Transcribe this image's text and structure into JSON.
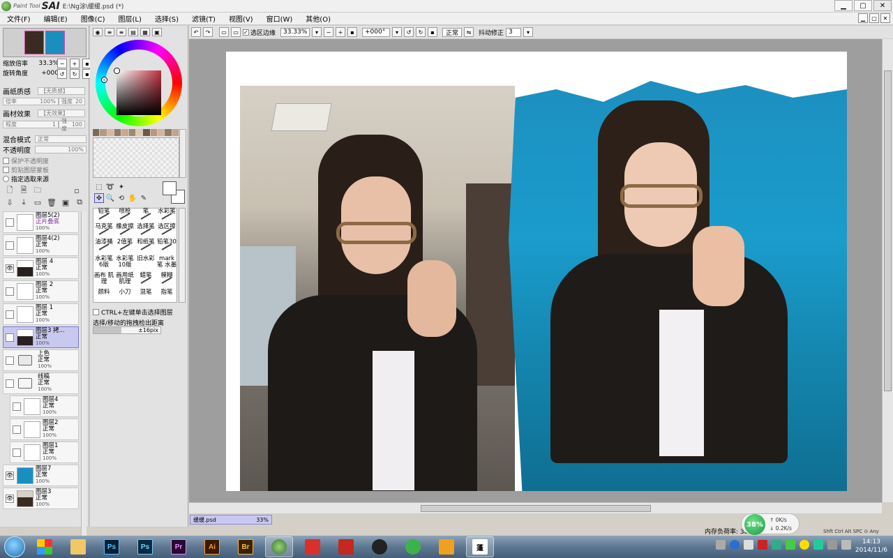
{
  "titlebar": {
    "app_small": "Paint Tool",
    "app_big": "SAI",
    "path": "E:\\Ng涂\\缓缓.psd (*)",
    "btn_min": "▁",
    "btn_max": "▢",
    "btn_close": "✕"
  },
  "menu": [
    "文件(F)",
    "编辑(E)",
    "图像(C)",
    "图层(L)",
    "选择(S)",
    "滤镜(T)",
    "视图(V)",
    "窗口(W)",
    "其他(O)"
  ],
  "nav": {
    "zoom_label": "缩放倍率",
    "zoom_value": "33.3%",
    "angle_label": "旋转角度",
    "angle_value": "+000"
  },
  "texture": {
    "paper_label": "画纸质感",
    "paper_value": "【无质感】",
    "mag_label": "倍率",
    "mag_value": "100%",
    "strength_label": "强度",
    "strength_value": "20",
    "effect_label": "画材效果",
    "effect_value": "【无效果】",
    "degree_label": "程度",
    "degree_value": "1",
    "effect_strength_label": "强度",
    "effect_strength_value": "100"
  },
  "blend": {
    "mode_label": "混合模式",
    "mode_value": "正常",
    "opacity_label": "不透明度",
    "opacity_value": "100%",
    "protect_opacity": "保护不透明度",
    "clip_group": "剪贴图层蒙板",
    "selection_source": "指定选取来源"
  },
  "layers": [
    {
      "name": "图层5(2)",
      "mode": "正片叠底",
      "opacity": "100%",
      "visible": false,
      "selected": false,
      "kind": "layer"
    },
    {
      "name": "图层4(2)",
      "mode": "正常",
      "opacity": "100%",
      "visible": false,
      "selected": false,
      "kind": "layer"
    },
    {
      "name": "图层 4",
      "mode": "正常",
      "opacity": "100%",
      "visible": true,
      "selected": false,
      "kind": "layer"
    },
    {
      "name": "图层 2",
      "mode": "正常",
      "opacity": "100%",
      "visible": false,
      "selected": false,
      "kind": "layer"
    },
    {
      "name": "图层 1",
      "mode": "正常",
      "opacity": "100%",
      "visible": false,
      "selected": false,
      "kind": "layer"
    },
    {
      "name": "图层3 拷...",
      "mode": "正常",
      "opacity": "100%",
      "visible": false,
      "selected": true,
      "kind": "layer"
    },
    {
      "name": "上色",
      "mode": "正常",
      "opacity": "100%",
      "visible": false,
      "selected": false,
      "kind": "folder"
    },
    {
      "name": "线稿",
      "mode": "正常",
      "opacity": "100%",
      "visible": false,
      "selected": false,
      "kind": "folder"
    },
    {
      "name": "图层4",
      "mode": "正常",
      "opacity": "100%",
      "visible": false,
      "selected": false,
      "kind": "sublayer"
    },
    {
      "name": "图层2",
      "mode": "正常",
      "opacity": "100%",
      "visible": false,
      "selected": false,
      "kind": "sublayer"
    },
    {
      "name": "图层1",
      "mode": "正常",
      "opacity": "100%",
      "visible": false,
      "selected": false,
      "kind": "sublayer"
    },
    {
      "name": "图层7",
      "mode": "正常",
      "opacity": "100%",
      "visible": true,
      "selected": false,
      "kind": "layer"
    },
    {
      "name": "图层3",
      "mode": "正常",
      "opacity": "100%",
      "visible": true,
      "selected": false,
      "kind": "layer"
    }
  ],
  "brushes": [
    [
      "铅笔",
      "喷枪",
      "笔",
      "水彩笔"
    ],
    [
      "马克笔",
      "橡皮擦",
      "选择笔",
      "选区擦"
    ],
    [
      "油漆桶",
      "2值笔",
      "和纸笔",
      "铅笔30"
    ],
    [
      "水彩笔 6版",
      "水彩笔 10版",
      "旧水彩",
      "mark笔 水墨"
    ],
    [
      "画布 肌理",
      "画用纸 肌理",
      "蜡笔",
      "模糊"
    ],
    [
      "颜料",
      "小刀",
      "混笔",
      "指笔"
    ]
  ],
  "options": {
    "ctrl_select": "CTRL+左键单击选择图层",
    "move_distance": "选择/移动的拖拽检出距离",
    "distance_value": "±16pix"
  },
  "toolbar": {
    "selection_edge": "选区边缘",
    "zoom": "33.33%",
    "angle": "+000°",
    "mode": "正常",
    "stabilizer_label": "抖动修正",
    "stabilizer_value": "3"
  },
  "file_tab": {
    "name": "缓缓.psd",
    "zoom": "33%"
  },
  "status": {
    "memory": "内存负荷率: 38%(975MB)",
    "net_percent": "38%",
    "up": "0K/s",
    "down": "0.2K/s",
    "keys": "Shft Ctrl Alt SPC ⊙ Any"
  },
  "taskbar": {
    "apps": [
      "Ps",
      "Ps",
      "Pr",
      "Ai",
      "Br"
    ],
    "time": "14:13",
    "date": "2014/11/6"
  },
  "colors": {
    "selected_layer": "#c9c9f0",
    "painting_bg": "#1a9ccc"
  }
}
